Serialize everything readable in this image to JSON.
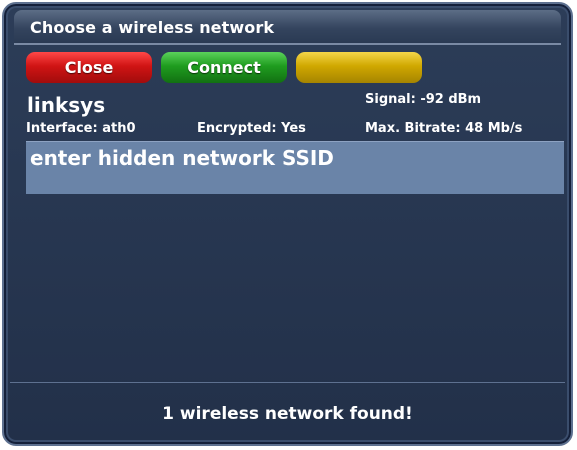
{
  "window": {
    "title": "Choose a wireless network"
  },
  "buttons": {
    "close_label": "Close",
    "connect_label": "Connect",
    "yellow_label": ""
  },
  "network": {
    "name": "linksys",
    "signal": "Signal: -92 dBm",
    "interface": "Interface: ath0",
    "encrypted": "Encrypted: Yes",
    "max_bitrate": "Max. Bitrate: 48 Mb/s"
  },
  "list": {
    "items": [
      {
        "label": "enter hidden network SSID"
      }
    ]
  },
  "status": {
    "text": "1 wireless network found!"
  },
  "colors": {
    "window_bg": "#26354f",
    "selected_row": "#6a84a8",
    "close_red": "#d01414",
    "connect_green": "#1f9c1f",
    "yellow": "#d0a800"
  }
}
